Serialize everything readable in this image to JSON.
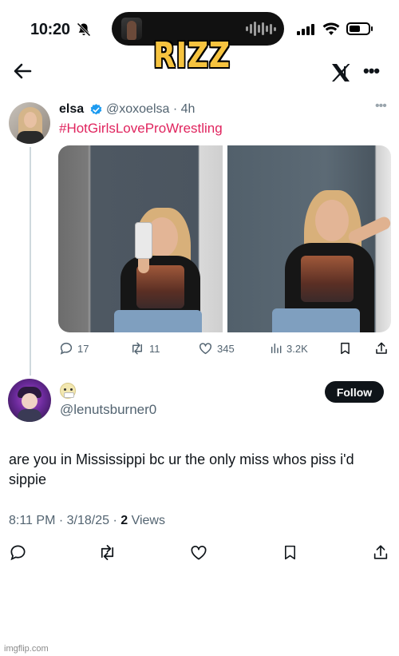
{
  "status_bar": {
    "time": "10:20"
  },
  "caption": "RIZZ",
  "parent_tweet": {
    "author_name": "elsa",
    "handle_time": "@xoxoelsa · 4h",
    "hashtag": "#HotGirlsLoveProWrestling",
    "replies": "17",
    "reposts": "11",
    "likes": "345",
    "views": "3.2K"
  },
  "reply": {
    "handle": "@lenutsburner0",
    "follow_label": "Follow",
    "text": "are you in Mississippi bc ur the only miss whos piss i'd sippie",
    "time_date": "8:11 PM · 3/18/25 · ",
    "views_count": "2",
    "views_label": " Views"
  },
  "colors": {
    "accent_verified": "#1d9bf0",
    "hashtag": "#e0245e",
    "caption": "#f6c33f",
    "secondary_text": "#536471"
  },
  "icons": [
    "back-arrow-icon",
    "x-logo-icon",
    "more-icon",
    "bell-off-icon",
    "signal-icon",
    "wifi-icon",
    "battery-icon",
    "verified-badge-icon",
    "reply-icon",
    "repost-icon",
    "like-icon",
    "views-icon",
    "bookmark-icon",
    "share-icon"
  ],
  "watermark": "imgflip.com"
}
